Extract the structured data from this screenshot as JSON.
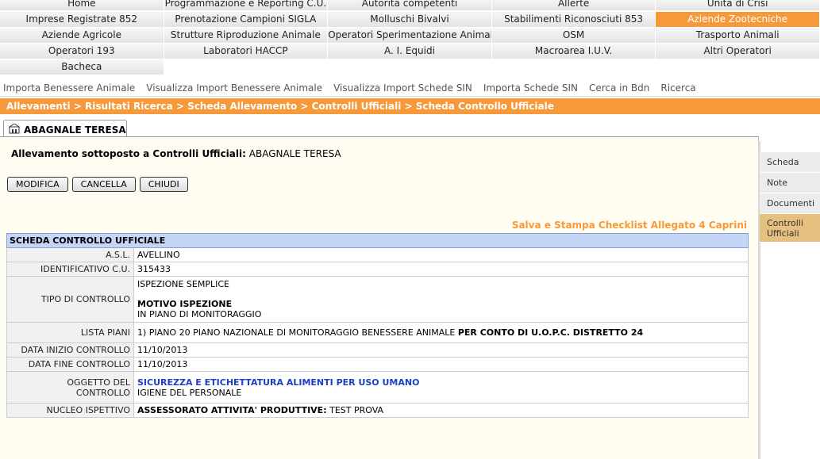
{
  "menu": {
    "row1": [
      "Home",
      "Programmazione e Reporting C.U.",
      "Autorita competenti",
      "Allerte",
      "Unità di Crisi"
    ],
    "row2": [
      "Imprese Registrate 852",
      "Prenotazione Campioni SIGLA",
      "Molluschi Bivalvi",
      "Stabilimenti Riconosciuti 853",
      "Aziende Zootecniche"
    ],
    "row3": [
      "Aziende Agricole",
      "Strutture Riproduzione Animale",
      "Operatori Sperimentazione Animale",
      "OSM",
      "Trasporto Animali"
    ],
    "row4": [
      "Operatori 193",
      "Laboratori HACCP",
      "A. I. Equidi",
      "Macroarea I.U.V.",
      "Altri Operatori"
    ],
    "row5": [
      "Bacheca"
    ]
  },
  "submenu": [
    "Importa Benessere Animale",
    "Visualizza Import Benessere Animale",
    "Visualizza Import Schede SIN",
    "Importa Schede SIN",
    "Cerca in Bdn",
    "Ricerca"
  ],
  "breadcrumb": "Allevamenti > Risultati Ricerca > Scheda Allevamento > Controlli Ufficiali > Scheda Controllo Ufficiale",
  "tab": {
    "label": "ABAGNALE TERESA",
    "icon": "building-icon"
  },
  "summary": {
    "label": "Allevamento sottoposto a Controlli Ufficiali:",
    "value": "ABAGNALE TERESA"
  },
  "buttons": {
    "modify": "MODIFICA",
    "delete": "CANCELLA",
    "close": "CHIUDI"
  },
  "print_link": "Salva e Stampa Checklist Allegato 4 Caprini",
  "sheet": {
    "title": "SCHEDA CONTROLLO UFFICIALE",
    "asl_label": "A.S.L.",
    "asl_value": "AVELLINO",
    "id_label": "IDENTIFICATIVO C.U.",
    "id_value": "315433",
    "tipo_label": "TIPO DI CONTROLLO",
    "tipo_value": "ISPEZIONE SEMPLICE",
    "motivo_label": "MOTIVO ISPEZIONE",
    "motivo_value": "IN PIANO DI MONITORAGGIO",
    "piani_label": "LISTA PIANI",
    "piani_value": "1) PIANO 20 PIANO NAZIONALE DI MONITORAGGIO BENESSERE ANIMALE",
    "piani_extra": "PER CONTO DI U.O.P.C. DISTRETTO 24",
    "inizio_label": "DATA INIZIO CONTROLLO",
    "inizio_value": "11/10/2013",
    "fine_label": "DATA FINE CONTROLLO",
    "fine_value": "11/10/2013",
    "oggetto_label": "OGGETTO DEL CONTROLLO",
    "oggetto_main": "SICUREZZA E ETICHETTATURA ALIMENTI PER USO UMANO",
    "oggetto_sub": "IGIENE DEL PERSONALE",
    "nucleo_label": "NUCLEO ISPETTIVO",
    "nucleo_role": "ASSESSORATO ATTIVITA' PRODUTTIVE:",
    "nucleo_value": "TEST PROVA"
  },
  "side_tabs": [
    "Scheda",
    "Note",
    "Documenti",
    "Controlli Ufficiali"
  ],
  "colors": {
    "accent": "#f5993b",
    "table_header": "#c5d5f7",
    "panel_bg": "#fffdf2",
    "active_side_tab": "#e6c07e"
  }
}
